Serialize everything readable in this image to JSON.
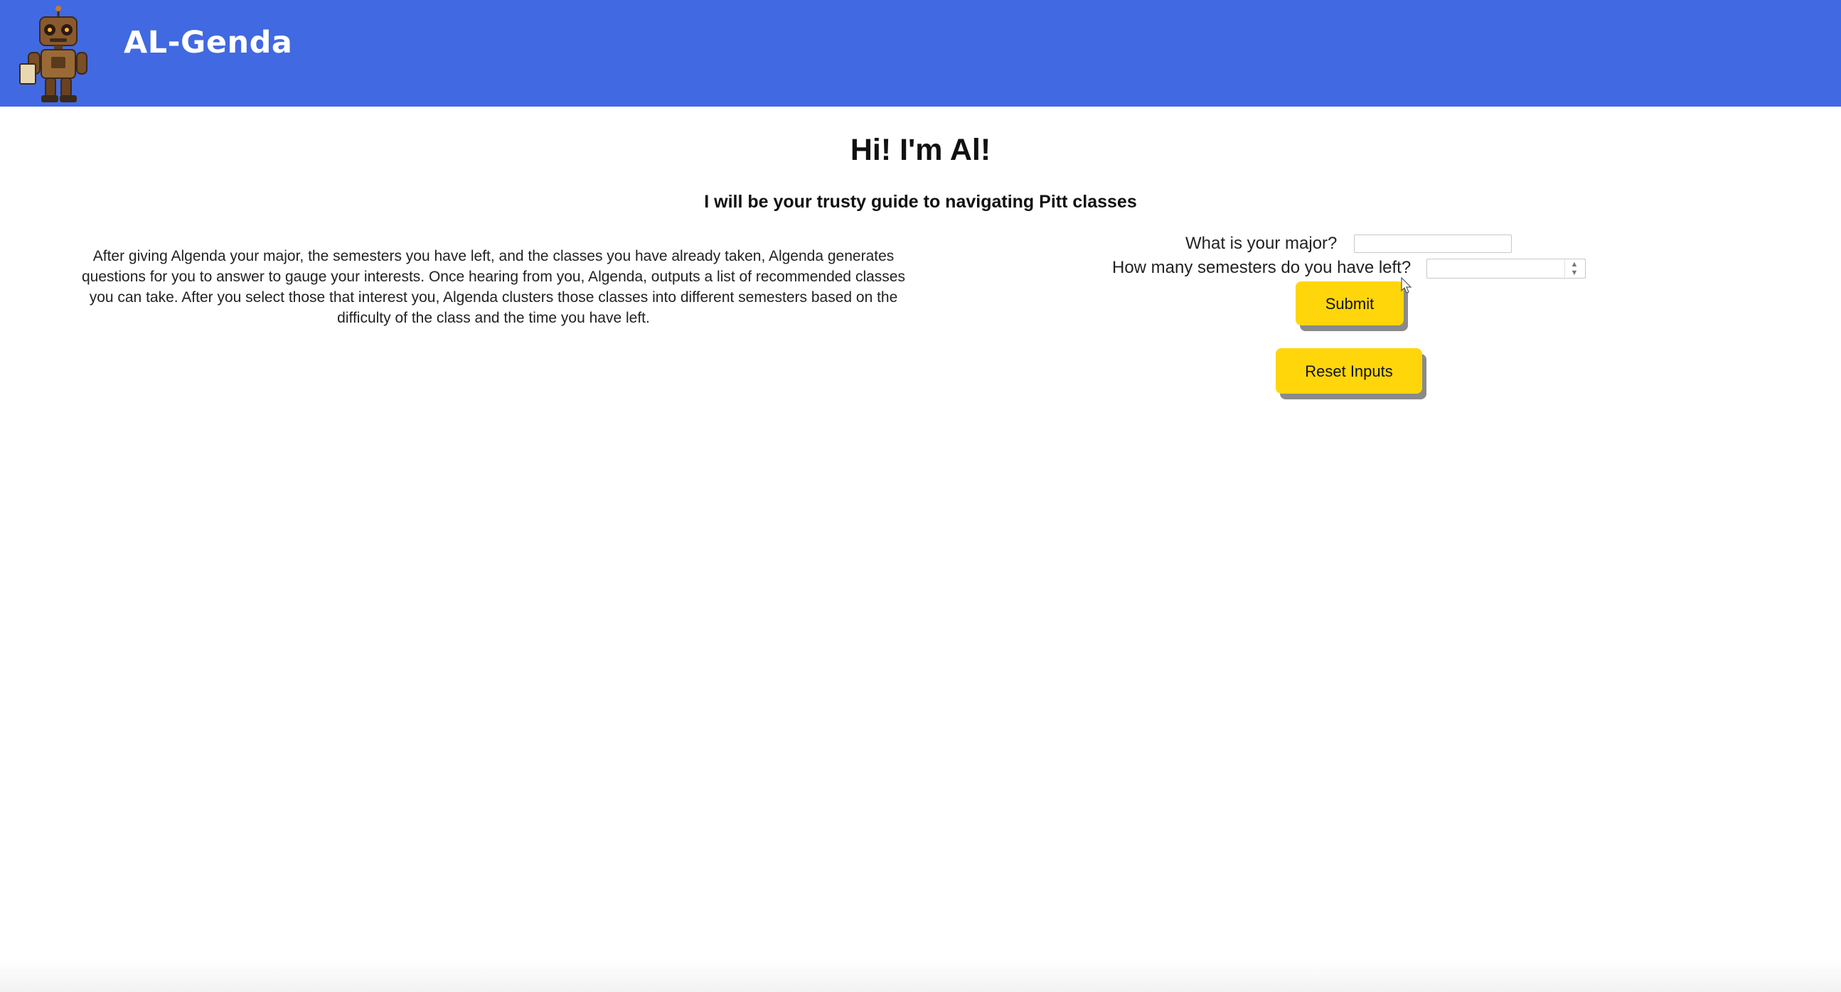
{
  "header": {
    "brand": "AL-Genda",
    "logo_icon": "robot-icon",
    "background_color": "#4169e1"
  },
  "hero": {
    "title": "Hi! I'm Al!",
    "subtitle": "I will be your trusty guide to navigating Pitt classes"
  },
  "description": "After giving Algenda your major, the semesters you have left, and the classes you have already taken, Algenda generates questions for you to answer to gauge your interests. Once hearing from you, Algenda, outputs a list of recommended classes you can take. After you select those that interest you, Algenda clusters those classes into different semesters based on the difficulty of the class and the time you have left.",
  "form": {
    "major_label": "What is your major?",
    "major_value": "",
    "semesters_label": "How many semesters do you have left?",
    "semesters_value": "",
    "submit_label": "Submit",
    "reset_label": "Reset Inputs",
    "button_color": "#ffd60a"
  }
}
